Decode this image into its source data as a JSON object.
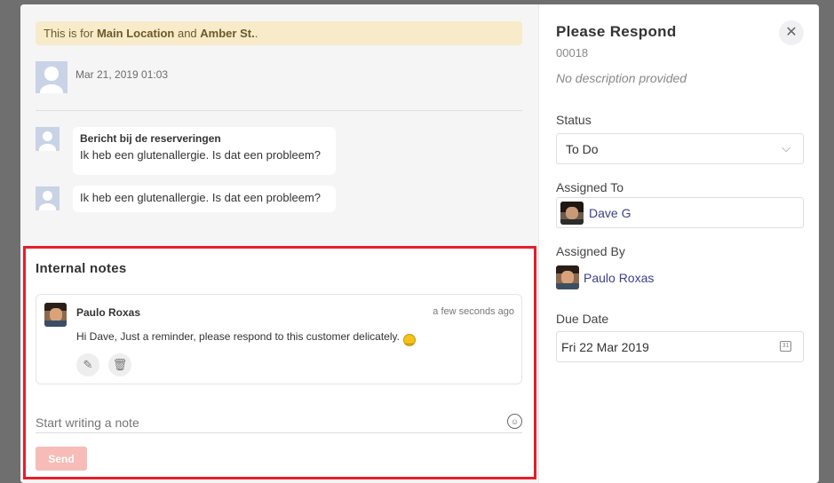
{
  "banner": {
    "prefix": "This is for ",
    "location": "Main Location",
    "joiner": " and ",
    "street": "Amber St.",
    "suffix": "."
  },
  "conversation": {
    "timestamp": "Mar 21, 2019 01:03",
    "messages": [
      {
        "title": "Bericht bij de reserveringen",
        "text": "Ik heb een glutenallergie. Is dat een probleem?"
      },
      {
        "title": "",
        "text": "Ik heb een glutenallergie. Is dat een probleem?"
      }
    ]
  },
  "notes": {
    "title": "Internal notes",
    "items": [
      {
        "author": "Paulo Roxas",
        "time": "a few seconds ago",
        "text": "Hi Dave, Just a reminder, please respond to this customer delicately."
      }
    ],
    "placeholder": "Start writing a note",
    "send_label": "Send"
  },
  "ticket": {
    "title": "Please Respond",
    "id": "00018",
    "description": "No description provided",
    "status_label": "Status",
    "status_value": "To Do",
    "assigned_to_label": "Assigned To",
    "assigned_to": "Dave G",
    "assigned_by_label": "Assigned By",
    "assigned_by": "Paulo Roxas",
    "due_label": "Due Date",
    "due_value": "Fri 22 Mar 2019"
  },
  "colors": {
    "accent": "#e41e2b",
    "send_disabled": "#f7bcb7",
    "banner": "#f7ebc9",
    "link": "#3b3f8c"
  },
  "icons": [
    "user-placeholder-icon",
    "pencil-icon",
    "trash-icon",
    "emoji-icon",
    "close-icon",
    "chevron-down-icon",
    "calendar-icon"
  ]
}
